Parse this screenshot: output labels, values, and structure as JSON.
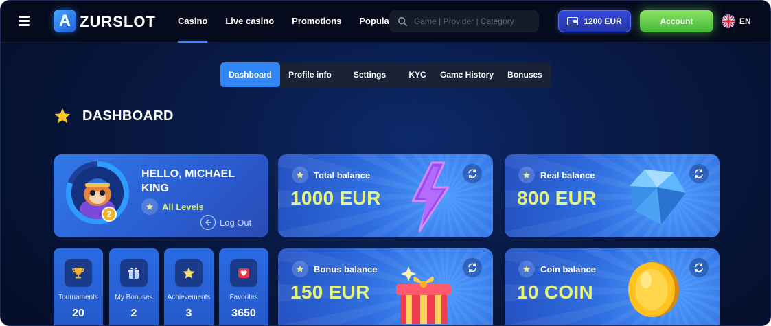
{
  "header": {
    "logo_letter": "A",
    "logo_text": "ZURSLOT",
    "nav": [
      "Casino",
      "Live casino",
      "Promotions",
      "Popular"
    ],
    "search_placeholder": "Game | Provider | Category",
    "balance": "1200 EUR",
    "account": "Account",
    "language": "EN"
  },
  "tabs": [
    "Dashboard",
    "Profile info",
    "Settings",
    "KYC",
    "Game History",
    "Bonuses"
  ],
  "page_title": "DASHBOARD",
  "profile": {
    "greeting": "HELLO, MICHAEL KING",
    "level": "2",
    "levels_link": "All Levels",
    "logout": "Log Out"
  },
  "stats": [
    {
      "label": "Tournaments",
      "value": "20",
      "icon": "trophy-icon"
    },
    {
      "label": "My Bonuses",
      "value": "2",
      "icon": "gift-icon"
    },
    {
      "label": "Achievements",
      "value": "3",
      "icon": "star-icon"
    },
    {
      "label": "Favorites",
      "value": "3650",
      "icon": "heart-icon"
    }
  ],
  "balances": {
    "total": {
      "label": "Total balance",
      "value": "1000 EUR"
    },
    "real": {
      "label": "Real balance",
      "value": "800 EUR"
    },
    "bonus": {
      "label": "Bonus balance",
      "value": "150 EUR"
    },
    "coin": {
      "label": "Coin balance",
      "value": "10 COIN"
    }
  },
  "colors": {
    "accent": "#2f86f4",
    "balance_value": "#e4f57c",
    "account_button": "#6fd24f"
  }
}
